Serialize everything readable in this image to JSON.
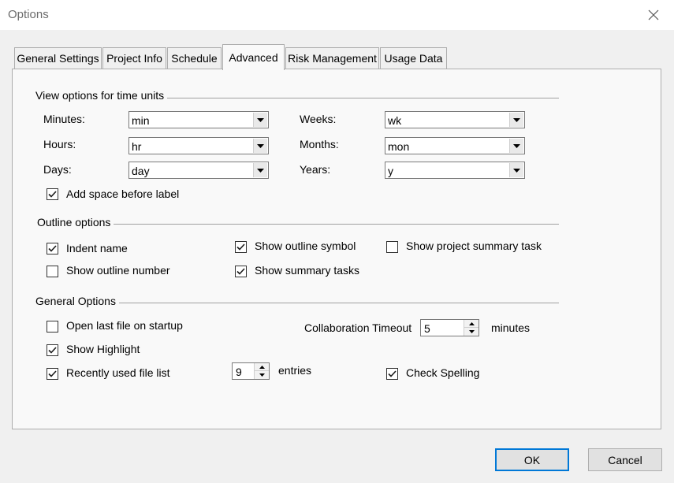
{
  "window": {
    "title": "Options"
  },
  "tabs": [
    {
      "label": "General Settings"
    },
    {
      "label": "Project Info"
    },
    {
      "label": "Schedule"
    },
    {
      "label": "Advanced",
      "active": true
    },
    {
      "label": "Risk Management"
    },
    {
      "label": "Usage Data"
    }
  ],
  "time_units": {
    "title": "View options for time units",
    "minutes": {
      "label": "Minutes:",
      "value": "min"
    },
    "hours": {
      "label": "Hours:",
      "value": "hr"
    },
    "days": {
      "label": "Days:",
      "value": "day"
    },
    "weeks": {
      "label": "Weeks:",
      "value": "wk"
    },
    "months": {
      "label": "Months:",
      "value": "mon"
    },
    "years": {
      "label": "Years:",
      "value": "y"
    },
    "add_space": {
      "label": "Add space before label",
      "checked": true
    }
  },
  "outline": {
    "title": "Outline options",
    "indent_name": {
      "label": "Indent name",
      "checked": true
    },
    "show_outline_number": {
      "label": "Show outline number",
      "checked": false
    },
    "show_outline_symbol": {
      "label": "Show outline symbol",
      "checked": true
    },
    "show_summary_tasks": {
      "label": "Show summary tasks",
      "checked": true
    },
    "show_project_summary": {
      "label": "Show project summary task",
      "checked": false
    }
  },
  "general": {
    "title": "General Options",
    "open_last_file": {
      "label": "Open last file on startup",
      "checked": false
    },
    "show_highlight": {
      "label": "Show Highlight",
      "checked": true
    },
    "recent_files": {
      "label": "Recently used file list",
      "checked": true,
      "count": "9",
      "suffix": "entries"
    },
    "collab_timeout": {
      "label": "Collaboration Timeout",
      "value": "5",
      "suffix": "minutes"
    },
    "check_spelling": {
      "label": "Check Spelling",
      "checked": true
    }
  },
  "buttons": {
    "ok": "OK",
    "cancel": "Cancel"
  },
  "colors": {
    "accent": "#0078d7",
    "check": "#1a1a1a"
  },
  "icons": {
    "close": "close-icon",
    "dropdown": "chevron-down-icon",
    "check": "checkmark-icon"
  }
}
